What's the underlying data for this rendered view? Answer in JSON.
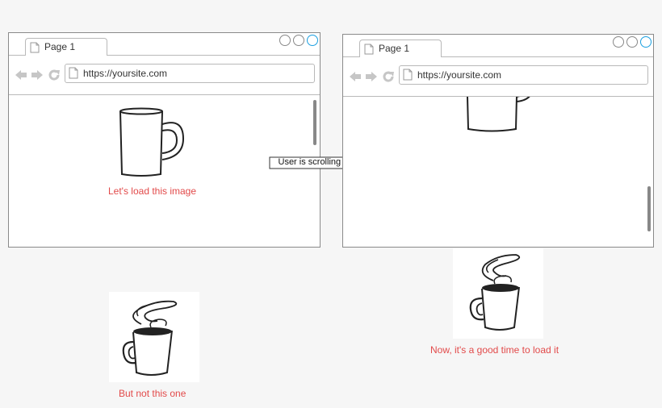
{
  "browsers": [
    {
      "tab_label": "Page 1",
      "url": "https://yoursite.com"
    },
    {
      "tab_label": "Page 1",
      "url": "https://yoursite.com"
    }
  ],
  "captions": {
    "load_image": "Let's load this image",
    "not_this_one": "But not this one",
    "good_time": "Now, it's a good time to load it"
  },
  "arrow_label": "User is scrolling down",
  "colors": {
    "caption": "#e24a4a",
    "close_circle": "#1a9fe0",
    "outline": "#8a8a8a"
  },
  "icons": [
    "page-icon",
    "back-arrow-icon",
    "forward-arrow-icon",
    "reload-icon",
    "mug-icon",
    "coffee-mug-icon"
  ]
}
